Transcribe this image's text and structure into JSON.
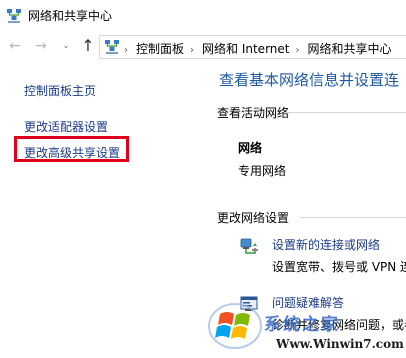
{
  "window": {
    "title": "网络和共享中心",
    "app_icon": "network-sharing-icon"
  },
  "navbar": {
    "back_icon": "←",
    "forward_icon": "→",
    "recent_icon": "⌄",
    "up_icon": "↑",
    "breadcrumbs": [
      "控制面板",
      "网络和 Internet",
      "网络和共享中心"
    ],
    "breadcrumb_sep": "›"
  },
  "left_pane": {
    "home_link": "控制面板主页",
    "adapter_link": "更改适配器设置",
    "advanced_sharing_link": "更改高级共享设置"
  },
  "main": {
    "title": "查看基本网络信息并设置连",
    "active_networks_label": "查看活动网络",
    "network_name": "网络",
    "network_type": "专用网络",
    "change_settings_label": "更改网络设置",
    "tasks": [
      {
        "link": "设置新的连接或网络",
        "desc": "设置宽带、拨号或 VPN 连",
        "icon": "new-connection-icon"
      },
      {
        "link": "问题疑难解答",
        "desc": "诊断并修复网络问题，或者",
        "icon": "troubleshoot-icon"
      }
    ]
  },
  "watermark": {
    "cn": "系统之家",
    "en": "Www.Winwin7.com"
  },
  "colors": {
    "link": "#1a3a8a",
    "title": "#1e5aa0",
    "highlight": "#e0001b"
  }
}
